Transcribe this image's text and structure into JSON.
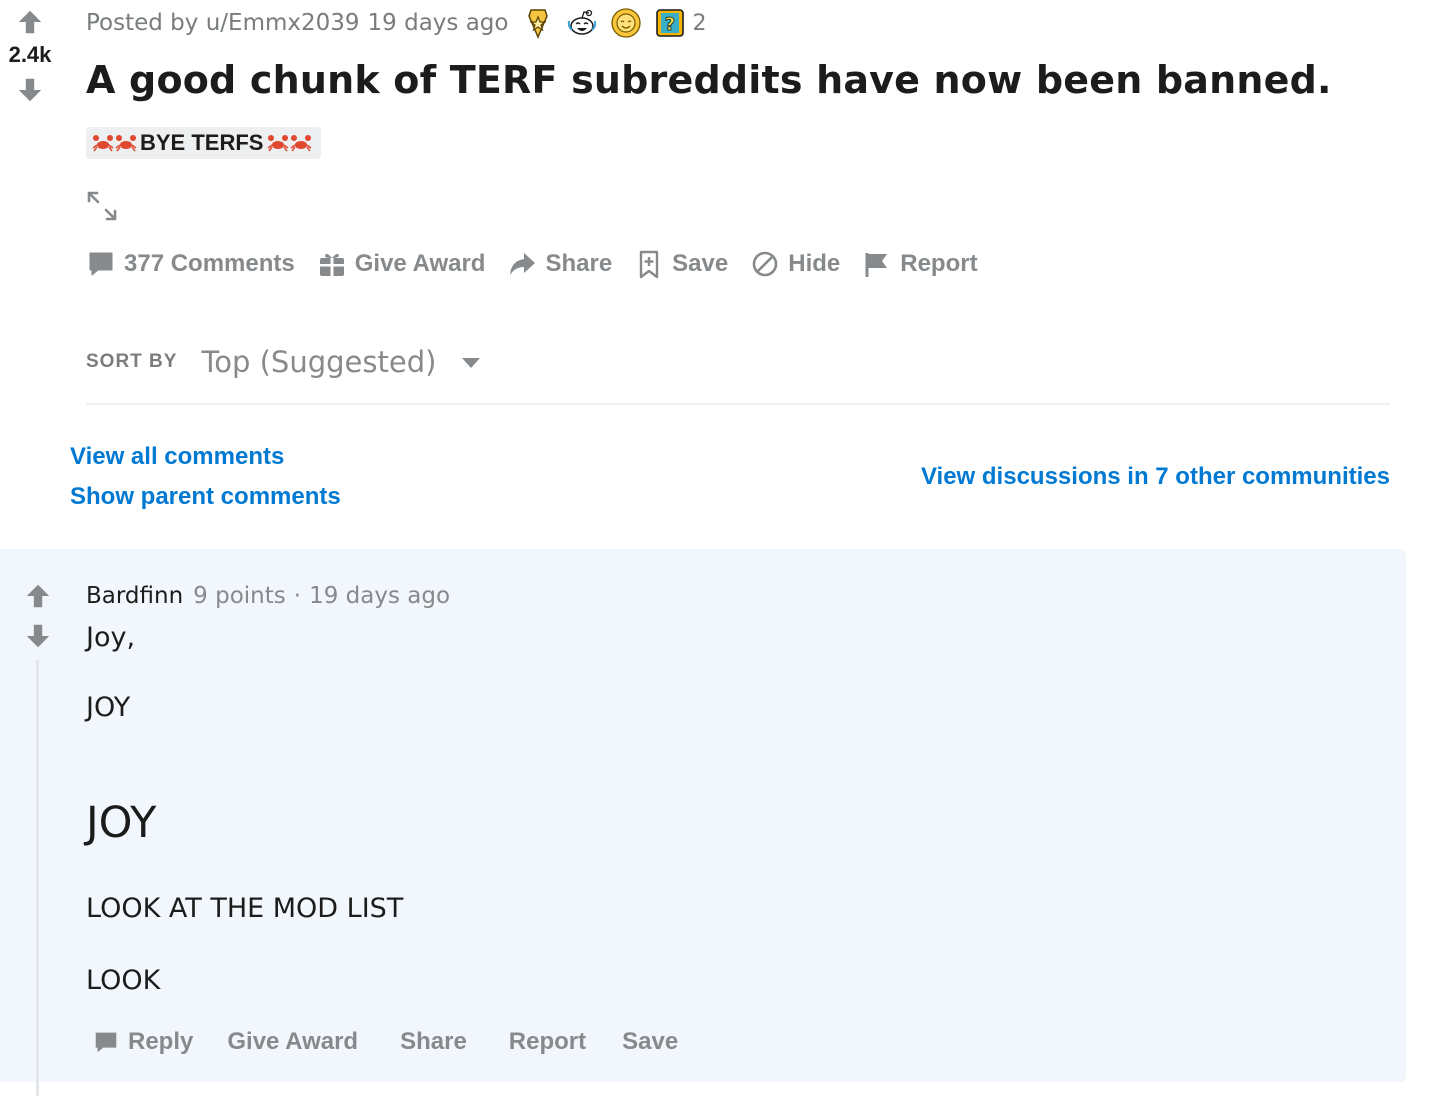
{
  "post": {
    "score": "2.4k",
    "posted_by": "Posted by u/Emmx2039",
    "age": "19 days ago",
    "award_icons": [
      "gold-star-award-icon",
      "snoo-laugh-award-icon",
      "sun-award-icon",
      "question-block-award-icon"
    ],
    "award_count": "2",
    "title": "A good chunk of TERF subreddits have now been banned.",
    "flair": {
      "text": "BYE TERFS",
      "emoji": "crab",
      "background": "#edeff1"
    },
    "actions": {
      "comments": "377 Comments",
      "give_award": "Give Award",
      "share": "Share",
      "save": "Save",
      "hide": "Hide",
      "report": "Report"
    }
  },
  "sort": {
    "label": "SORT BY",
    "value": "Top (Suggested)"
  },
  "links": {
    "view_all": "View all comments",
    "show_parent": "Show parent comments",
    "other_communities": "View discussions in 7 other communities"
  },
  "comment": {
    "author": "Bardfinn",
    "points": "9 points",
    "separator": "·",
    "age": "19 days ago",
    "body": {
      "line1": "Joy,",
      "line2": "JOY",
      "heading": "JOY",
      "line3": "LOOK AT THE MOD LIST",
      "line4": "LOOK"
    },
    "actions": {
      "reply": "Reply",
      "give_award": "Give Award",
      "share": "Share",
      "report": "Report",
      "save": "Save"
    }
  },
  "colors": {
    "link_blue": "#0079d3",
    "meta_gray": "#878a8c",
    "text": "#1c1c1c",
    "comment_bg": "#f2f7fd",
    "vote_gray": "#878a8c"
  }
}
